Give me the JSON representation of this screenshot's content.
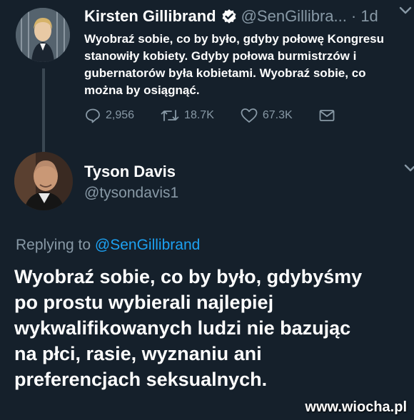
{
  "tweet1": {
    "name": "Kirsten Gillibrand",
    "handle": "@SenGillibra...",
    "time": "· 1d",
    "text": "Wyobraź sobie, co by było, gdyby połowę Kongresu stanowiły kobiety. Gdyby połowa burmistrzów i gubernatorów była kobietami. Wyobraź sobie, co można by osiągnąć.",
    "replies": "2,956",
    "retweets": "18.7K",
    "likes": "67.3K"
  },
  "tweet2": {
    "name": "Tyson Davis",
    "handle": "@tysondavis1",
    "replying_prefix": "Replying to ",
    "replying_handle": "@SenGillibrand",
    "text": "Wyobraź sobie, co by było, gdybyśmy\npo prostu wybierali najlepiej\nwykwalifikowanych ludzi nie bazując\nna płci, rasie, wyznaniu ani\npreferencjach seksualnych."
  },
  "watermark": "www.wiocha.pl",
  "colors": {
    "background": "#15202b",
    "secondary_text": "#8899a6",
    "link": "#1da1f2"
  },
  "icons": [
    "verified-badge-icon",
    "caret-down-icon",
    "reply-icon",
    "retweet-icon",
    "like-icon",
    "message-icon"
  ]
}
